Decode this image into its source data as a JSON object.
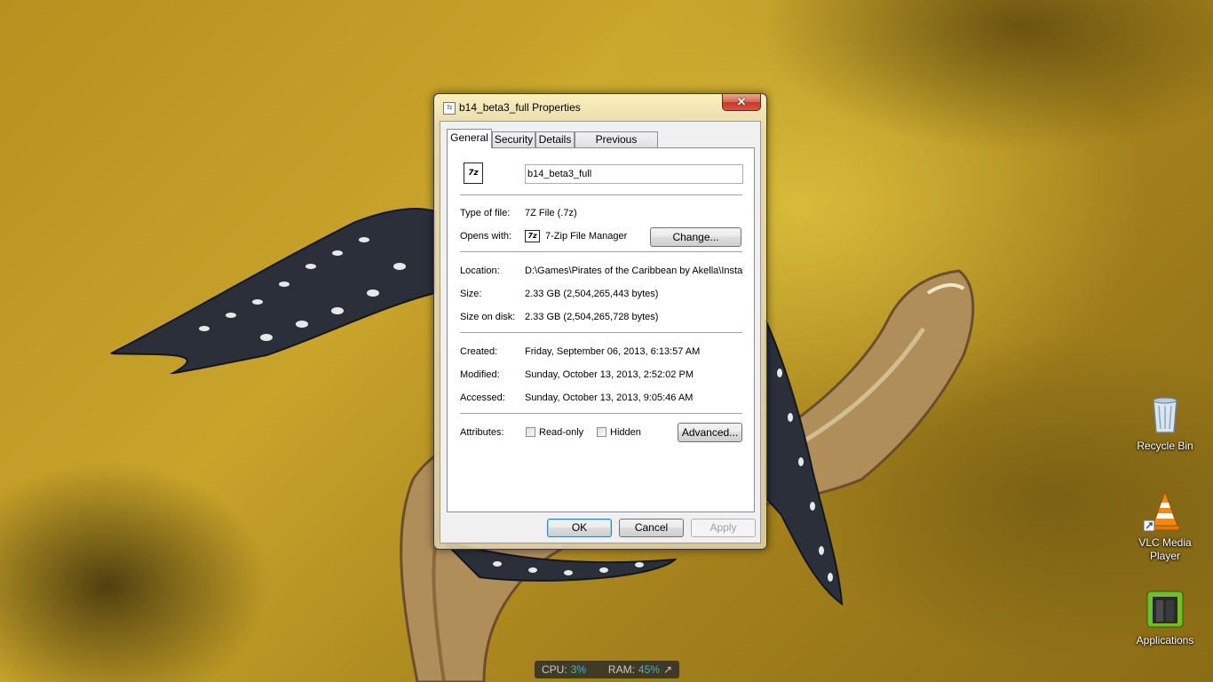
{
  "dialog": {
    "title": "b14_beta3_full Properties",
    "close_glyph": "✕",
    "tabs": [
      "General",
      "Security",
      "Details",
      "Previous Versions"
    ],
    "active_tab": "General",
    "file_name": "b14_beta3_full",
    "file_icon_text": "7z",
    "rows": {
      "type_label": "Type of file:",
      "type_value": "7Z File (.7z)",
      "opens_label": "Opens with:",
      "opens_value": "7-Zip File Manager",
      "opens_icon_text": "7z",
      "change_button": "Change...",
      "location_label": "Location:",
      "location_value": "D:\\Games\\Pirates of the Caribbean by Akella\\Installer",
      "size_label": "Size:",
      "size_value": "2.33 GB (2,504,265,443 bytes)",
      "disk_label": "Size on disk:",
      "disk_value": "2.33 GB (2,504,265,728 bytes)",
      "created_label": "Created:",
      "created_value": "Friday, September 06, 2013, 6:13:57 AM",
      "modified_label": "Modified:",
      "modified_value": "Sunday, October 13, 2013, 2:52:02 PM",
      "accessed_label": "Accessed:",
      "accessed_value": "Sunday, October 13, 2013, 9:05:46 AM",
      "attributes_label": "Attributes:",
      "readonly_label": "Read-only",
      "readonly_checked": false,
      "hidden_label": "Hidden",
      "hidden_checked": false,
      "advanced_button": "Advanced..."
    },
    "buttons": {
      "ok": "OK",
      "cancel": "Cancel",
      "apply": "Apply"
    }
  },
  "desktop_icons": [
    {
      "label": "Recycle Bin",
      "icon": "recycle-bin-icon"
    },
    {
      "label": "VLC Media Player",
      "icon": "vlc-cone-icon"
    },
    {
      "label": "Applications",
      "icon": "applications-folder-icon"
    }
  ],
  "gadget": {
    "cpu_label": "CPU:",
    "cpu_value": "3%",
    "ram_label": "RAM:",
    "ram_value": "45%",
    "expand_glyph": "↗"
  },
  "colors": {
    "wallpaper": "#c8a42b",
    "gadget_value": "#3fb6d6",
    "close_button": "#c23a26"
  }
}
